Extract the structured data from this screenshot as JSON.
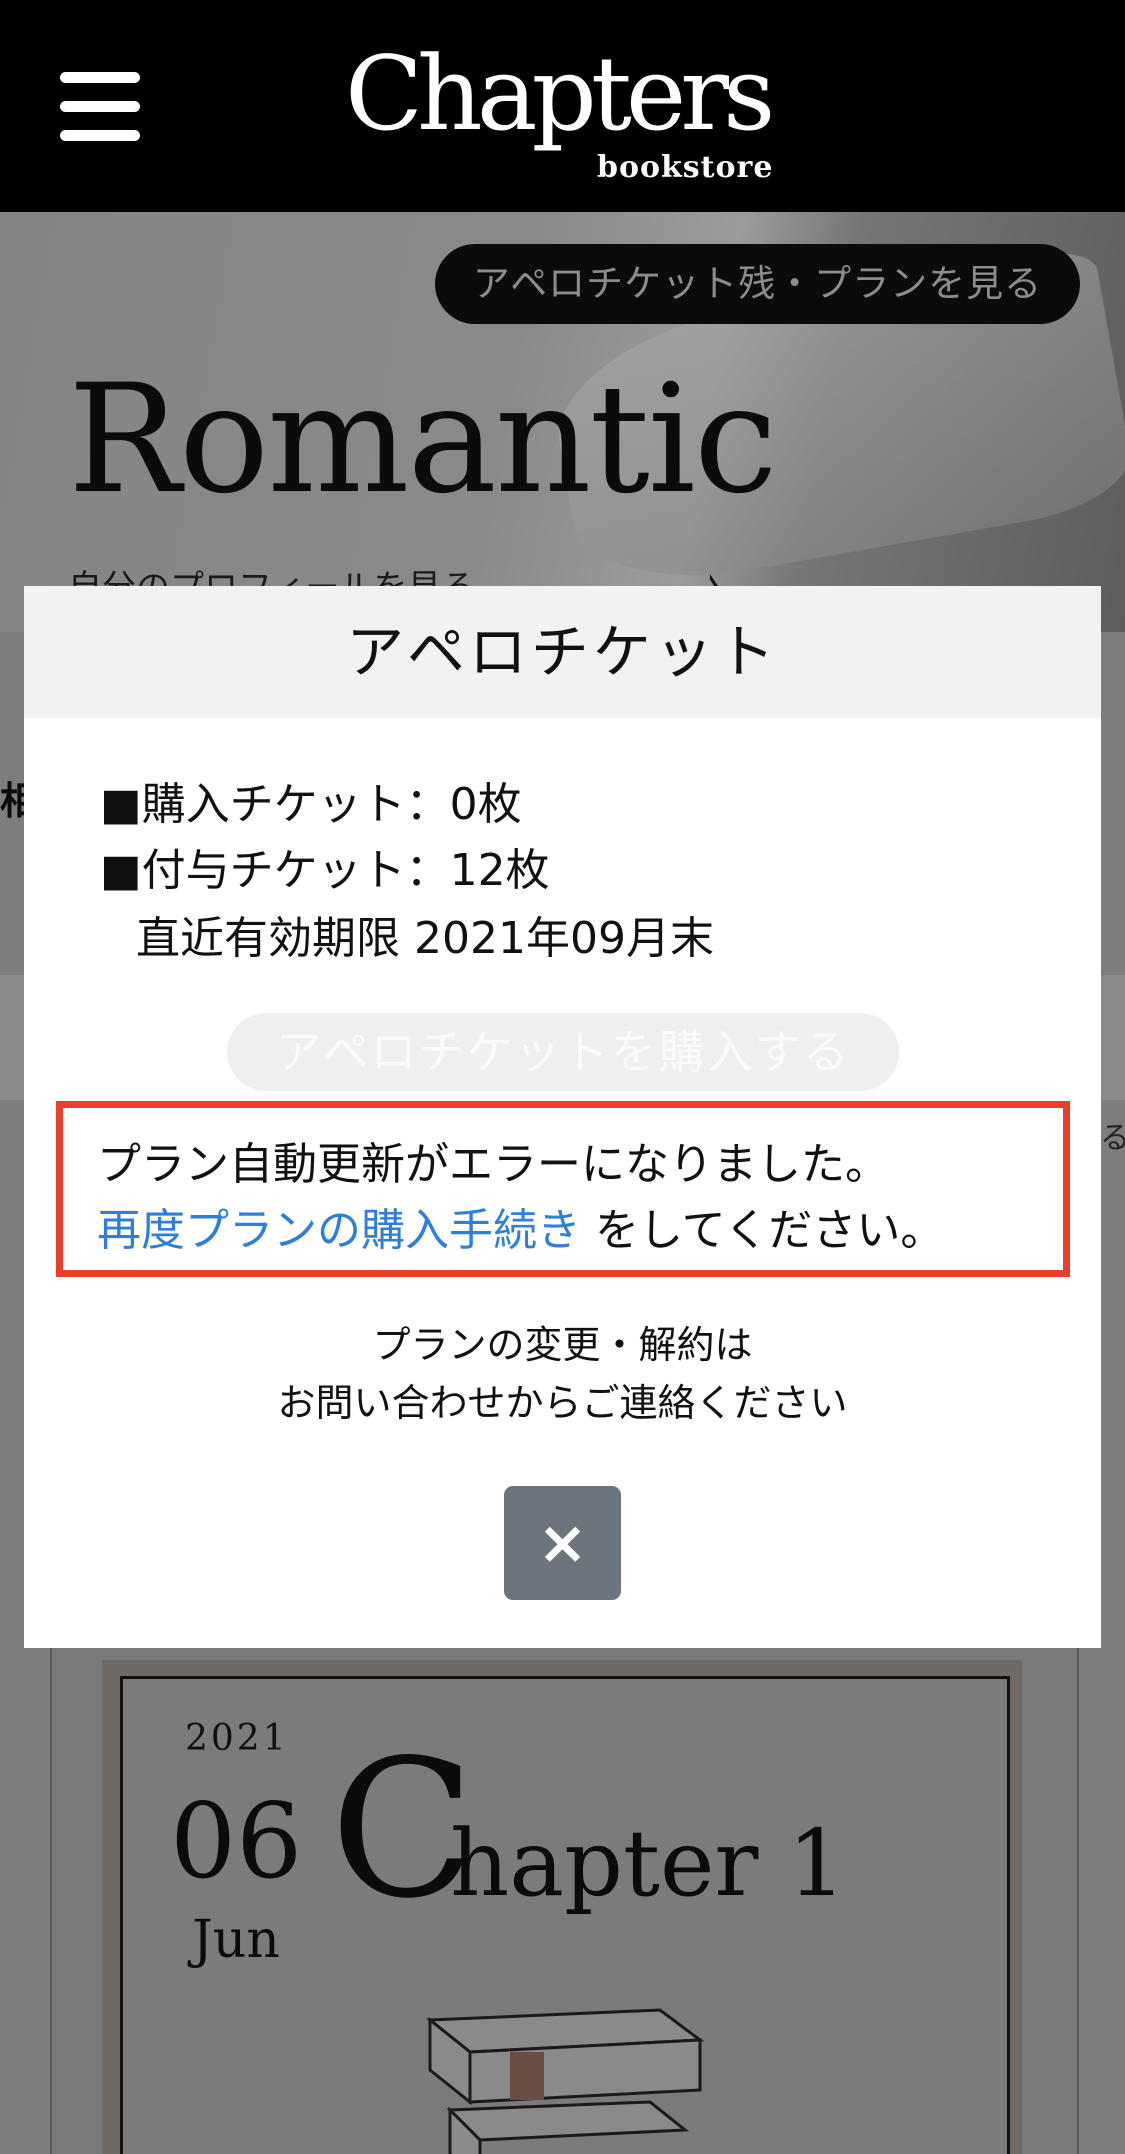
{
  "header": {
    "logo_main": "Chapters",
    "logo_sub": "bookstore"
  },
  "hero": {
    "plan_button": "アペロチケット残・プランを見る",
    "title": "Romantic",
    "profile_link": "自分のプロフィールを見る",
    "profile_arrow": "›"
  },
  "background": {
    "left_fragment": "相",
    "right_fragment": "る"
  },
  "chapter_card": {
    "year": "2021",
    "day": "06",
    "month": "Jun",
    "big_letter": "C",
    "title_rest": "hapter 1"
  },
  "modal": {
    "title": "アペロチケット",
    "purchased_tickets": "■購入チケット：0枚",
    "granted_tickets": "■付与チケット：12枚",
    "expiry": "直近有効期限 2021年09月末",
    "buy_button": "アペロチケットを購入する",
    "error_line1": "プラン自動更新がエラーになりました。",
    "error_link": "再度プランの購入手続き",
    "error_line2_rest": " をしてください。",
    "note_line1": "プランの変更・解約は",
    "note_line2": "お問い合わせからご連絡ください",
    "close_label": "×"
  },
  "colors": {
    "error_border": "#e8402a",
    "link": "#2f7fd8",
    "close_button": "#6c757d"
  }
}
